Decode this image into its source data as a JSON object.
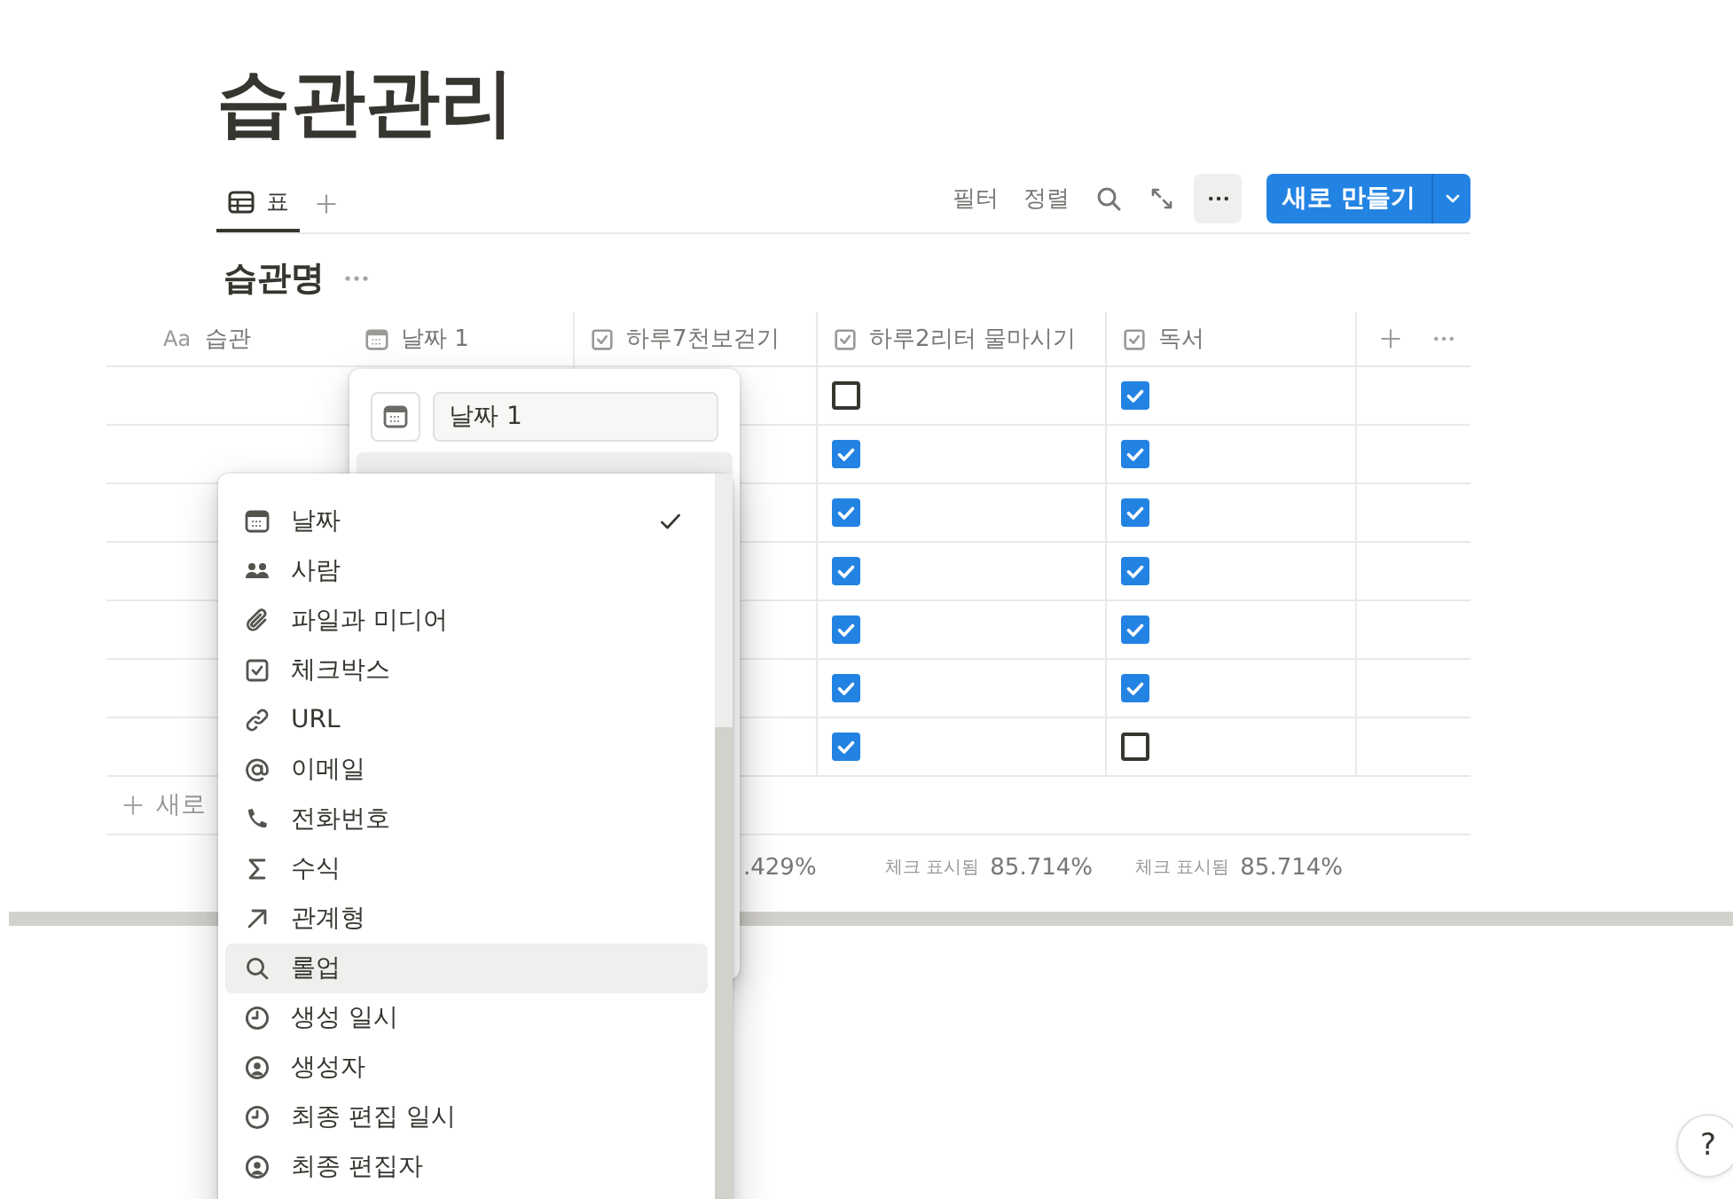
{
  "page": {
    "title": "습관관리"
  },
  "views": [
    {
      "label": "표",
      "selected": true
    }
  ],
  "toolbar": {
    "actions": [
      "필터",
      "정렬"
    ],
    "new_button": "새로 만들기"
  },
  "database": {
    "title": "습관명"
  },
  "table": {
    "columns": [
      {
        "kind": "title",
        "icon_text": "Aa",
        "label": "습관"
      },
      {
        "kind": "date",
        "label": "날짜 1"
      },
      {
        "kind": "checkbox",
        "label": "하루7천보걷기"
      },
      {
        "kind": "checkbox",
        "label": "하루2리터 물마시기"
      },
      {
        "kind": "checkbox",
        "label": "독서"
      }
    ],
    "rows": [
      {
        "water": {
          "checked": false
        },
        "reading": {
          "checked": true
        }
      },
      {
        "water": {
          "checked": true
        },
        "reading": {
          "checked": true
        }
      },
      {
        "water": {
          "checked": true
        },
        "reading": {
          "checked": true
        }
      },
      {
        "water": {
          "checked": true
        },
        "reading": {
          "checked": true
        }
      },
      {
        "water": {
          "checked": true
        },
        "reading": {
          "checked": true
        }
      },
      {
        "water": {
          "checked": true
        },
        "reading": {
          "checked": true
        }
      },
      {
        "water": {
          "checked": true
        },
        "reading": {
          "checked": false
        }
      }
    ],
    "new_row": "새로",
    "summary": [
      {
        "kind": "partial",
        "text": ".429%"
      },
      {
        "kind": "full",
        "label": "체크 표시됨",
        "value": "85.714%"
      },
      {
        "kind": "full",
        "label": "체크 표시됨",
        "value": "85.714%"
      }
    ]
  },
  "property_editor": {
    "name": "날짜 1"
  },
  "type_menu": {
    "items": [
      {
        "kind": "date",
        "label": "날짜",
        "selected": true,
        "hovered": false
      },
      {
        "kind": "person",
        "label": "사람",
        "selected": false,
        "hovered": false
      },
      {
        "kind": "file",
        "label": "파일과 미디어",
        "selected": false,
        "hovered": false
      },
      {
        "kind": "checkbox",
        "label": "체크박스",
        "selected": false,
        "hovered": false
      },
      {
        "kind": "url",
        "label": "URL",
        "selected": false,
        "hovered": false
      },
      {
        "kind": "email",
        "label": "이메일",
        "selected": false,
        "hovered": false
      },
      {
        "kind": "phone",
        "label": "전화번호",
        "selected": false,
        "hovered": false
      },
      {
        "kind": "formula",
        "label": "수식",
        "selected": false,
        "hovered": false
      },
      {
        "kind": "relation",
        "label": "관계형",
        "selected": false,
        "hovered": false
      },
      {
        "kind": "rollup",
        "label": "롤업",
        "selected": false,
        "hovered": true
      },
      {
        "kind": "created_time",
        "label": "생성 일시",
        "selected": false,
        "hovered": false
      },
      {
        "kind": "created_by",
        "label": "생성자",
        "selected": false,
        "hovered": false
      },
      {
        "kind": "last_edited_time",
        "label": "최종 편집 일시",
        "selected": false,
        "hovered": false
      },
      {
        "kind": "last_edited_by",
        "label": "최종 편집자",
        "selected": false,
        "hovered": false
      }
    ]
  },
  "help": "?"
}
